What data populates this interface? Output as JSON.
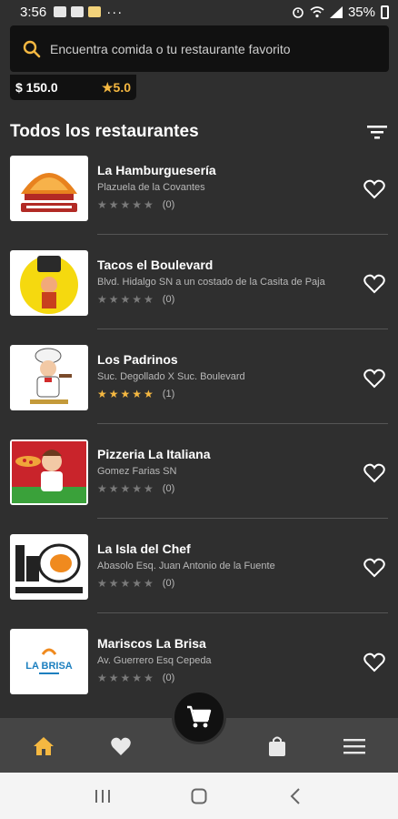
{
  "status_bar": {
    "time": "3:56",
    "more": "···",
    "battery": "35%"
  },
  "search": {
    "placeholder": "Encuentra comida o tu restaurante favorito"
  },
  "promo": {
    "price": "$ 150.0",
    "rating": "★5.0"
  },
  "section": {
    "title": "Todos los restaurantes"
  },
  "restaurants": [
    {
      "name": "La Hamburguesería",
      "address": "Plazuela de la Covantes",
      "stars": "★★★★★",
      "filled": false,
      "count": "(0)",
      "logo": "burger-logo"
    },
    {
      "name": "Tacos el Boulevard",
      "address": "Blvd. Hidalgo SN a un costado de la Casita de Paja",
      "stars": "★★★★★",
      "filled": false,
      "count": "(0)",
      "logo": "taco-logo"
    },
    {
      "name": "Los Padrinos",
      "address": "Suc. Degollado X Suc. Boulevard",
      "stars": "★★★★★",
      "filled": true,
      "count": "(1)",
      "logo": "chef-logo"
    },
    {
      "name": "Pizzeria La Italiana",
      "address": "Gomez Farias SN",
      "stars": "★★★★★",
      "filled": false,
      "count": "(0)",
      "logo": "pizza-logo"
    },
    {
      "name": "La Isla del Chef",
      "address": "Abasolo Esq. Juan Antonio de la Fuente",
      "stars": "★★★★★",
      "filled": false,
      "count": "(0)",
      "logo": "isla-logo"
    },
    {
      "name": "Mariscos La Brisa",
      "address": "Av. Guerrero Esq Cepeda",
      "stars": "★★★★★",
      "filled": false,
      "count": "(0)",
      "logo": "brisa-logo"
    }
  ],
  "logos": {
    "brisa_text": "LA BRISA"
  },
  "colors": {
    "accent": "#f5b841",
    "background": "#2f2f2f",
    "nav_bg": "#454545",
    "bar_bg": "#111111"
  },
  "bottom_nav": {
    "items": [
      "home-icon",
      "heart-icon",
      "cart-icon",
      "bag-icon",
      "menu-icon"
    ]
  }
}
